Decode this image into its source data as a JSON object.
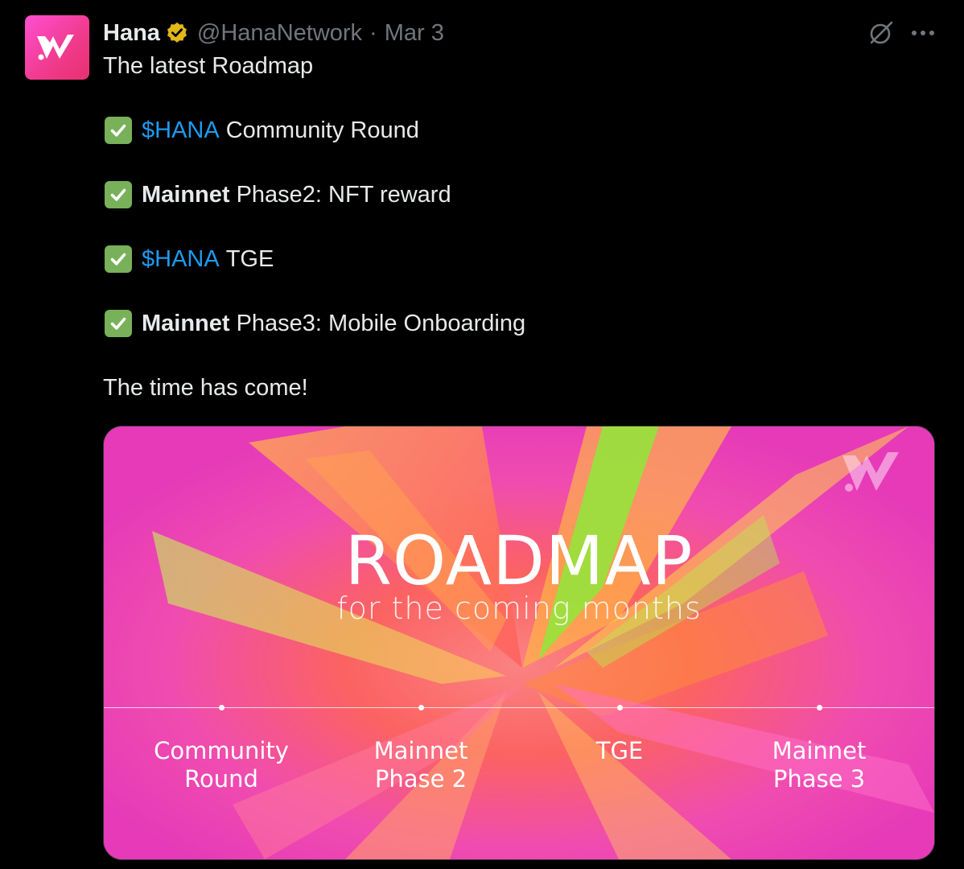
{
  "author": {
    "display_name": "Hana",
    "handle": "@HanaNetwork",
    "separator": "·",
    "date": "Mar 3",
    "avatar_icon": "hana-w-logo-icon",
    "avatar_colors": [
      "#ff4fd1",
      "#e8306e"
    ],
    "verified_color": "#e2b719"
  },
  "actions": {
    "grok_icon": "grok-icon",
    "more_icon": "more-dots-icon"
  },
  "tweet": {
    "intro": "The latest Roadmap",
    "items": [
      {
        "check": "✅",
        "lead": "$HANA",
        "lead_type": "cashtag",
        "rest": "Community Round"
      },
      {
        "check": "✅",
        "lead": "Mainnet",
        "lead_type": "bold",
        "rest": "Phase2: NFT reward"
      },
      {
        "check": "✅",
        "lead": "$HANA",
        "lead_type": "cashtag",
        "rest": "TGE"
      },
      {
        "check": "✅",
        "lead": "Mainnet",
        "lead_type": "bold",
        "rest": "Phase3: Mobile Onboarding"
      }
    ],
    "outro": "The time has come!"
  },
  "media": {
    "title": "ROADMAP",
    "subtitle": "for the coming months",
    "milestones": [
      {
        "label": "Community\nRound"
      },
      {
        "label": "Mainnet\nPhase 2"
      },
      {
        "label": "TGE"
      },
      {
        "label": "Mainnet\nPhase 3"
      }
    ],
    "colors": {
      "background": "#e83fb5",
      "accent_orange": "#ff7a3d",
      "accent_green": "#8fe83a",
      "text": "#ffffff"
    }
  },
  "colors": {
    "link": "#1d9bf0",
    "text": "#e7e9ea",
    "muted": "#71767b",
    "check_bg": "#78b159"
  }
}
